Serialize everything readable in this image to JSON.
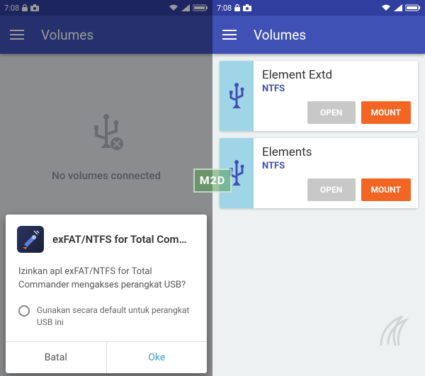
{
  "status": {
    "time": "7:08",
    "icons": [
      "lock-icon",
      "camera-icon"
    ]
  },
  "appbar": {
    "title": "Volumes"
  },
  "left": {
    "empty_text": "No volumes connected",
    "dialog": {
      "app_name": "exFAT/NTFS for Total Comm…",
      "message": "Izinkan apl exFAT/NTFS for Total Commander mengakses perangkat USB?",
      "checkbox_label": "Gunakan secara default untuk perangkat USB ini",
      "cancel": "Batal",
      "ok": "Oke"
    }
  },
  "right": {
    "volumes": [
      {
        "name": "Element Extd",
        "fs": "NTFS",
        "open": "OPEN",
        "mount": "MOUNT"
      },
      {
        "name": "Elements",
        "fs": "NTFS",
        "open": "OPEN",
        "mount": "MOUNT"
      }
    ]
  },
  "watermark": "M2D"
}
